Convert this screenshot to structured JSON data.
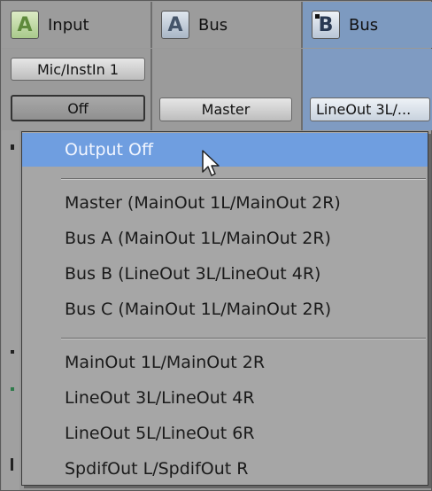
{
  "header": {
    "input": {
      "badge": "A",
      "label": "Input"
    },
    "bus_a": {
      "badge": "A",
      "label": "Bus"
    },
    "bus_b": {
      "badge": "B",
      "label": "Bus"
    }
  },
  "input_strip": {
    "source_label": "Mic/InstIn 1",
    "output_label": "Off"
  },
  "bus_a_strip": {
    "output_label": "Master"
  },
  "bus_b_strip": {
    "output_label": "LineOut 3L/..."
  },
  "menu": {
    "items": [
      {
        "label": "Output Off",
        "selected": true
      },
      {
        "label": "Master (MainOut 1L/MainOut 2R)"
      },
      {
        "label": "Bus A (MainOut 1L/MainOut 2R)"
      },
      {
        "label": "Bus B (LineOut 3L/LineOut 4R)"
      },
      {
        "label": "Bus C (MainOut 1L/MainOut 2R)"
      },
      {
        "label": "MainOut 1L/MainOut 2R"
      },
      {
        "label": "LineOut 3L/LineOut 4R"
      },
      {
        "label": "LineOut 5L/LineOut 6R"
      },
      {
        "label": "SpdifOut L/SpdifOut R"
      }
    ]
  },
  "colors": {
    "selection": "#6f9ee0",
    "bus_b_header": "#7d9ac0",
    "badge_green": "#5f8a3c"
  },
  "icons": {
    "input_badge": "letter-a-green-icon",
    "bus_a_badge": "letter-a-blue-icon",
    "bus_b_badge": "letter-b-blue-icon",
    "pointer": "arrow-cursor-icon"
  }
}
